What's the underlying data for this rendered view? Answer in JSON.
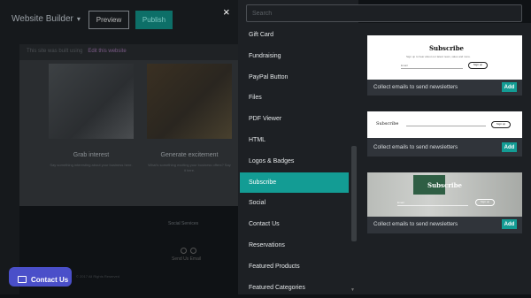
{
  "editor": {
    "brand": "Website Builder",
    "preview_label": "Preview",
    "publish_label": "Publish",
    "close_symbol": "×",
    "address_text": "This site was built using",
    "address_link": "Edit this website",
    "features": [
      {
        "title": "Grab interest",
        "desc": "Say something interesting about your business here."
      },
      {
        "title": "Generate excitement",
        "desc": "What's something exciting your business offers? Say it here."
      }
    ],
    "social_title": "Social   Services",
    "small_link": "Send Us Email",
    "footer_text": "© 2017 All Rights Reserved"
  },
  "contact_button": {
    "label": "Contact Us",
    "icon": "chat-icon"
  },
  "search": {
    "placeholder": "Search",
    "value": ""
  },
  "menu": {
    "items": [
      {
        "label": "Gift Card",
        "active": false
      },
      {
        "label": "Fundraising",
        "active": false
      },
      {
        "label": "PayPal Button",
        "active": false
      },
      {
        "label": "Files",
        "active": false
      },
      {
        "label": "PDF Viewer",
        "active": false
      },
      {
        "label": "HTML",
        "active": false
      },
      {
        "label": "Logos & Badges",
        "active": false
      },
      {
        "label": "Subscribe",
        "active": true
      },
      {
        "label": "Social",
        "active": false
      },
      {
        "label": "Contact Us",
        "active": false
      },
      {
        "label": "Reservations",
        "active": false
      },
      {
        "label": "Featured Products",
        "active": false
      },
      {
        "label": "Featured Categories",
        "active": false
      }
    ]
  },
  "tiles": [
    {
      "description": "Collect emails to send newsletters",
      "add_label": "Add",
      "preview_title": "Subscribe",
      "preview_text": "Sign up to hear about our latest news, sales and more.",
      "pill": "Sign up",
      "field": "Email"
    },
    {
      "description": "Collect emails to send newsletters",
      "add_label": "Add",
      "preview_title": "Subscribe",
      "pill": "Sign up"
    },
    {
      "description": "Collect emails to send newsletters",
      "add_label": "Add",
      "preview_title": "Subscribe",
      "pill": "Sign up",
      "field": "Email"
    }
  ],
  "colors": {
    "accent": "#139c94",
    "contact": "#4a4fc9",
    "panel": "#1d2024"
  }
}
